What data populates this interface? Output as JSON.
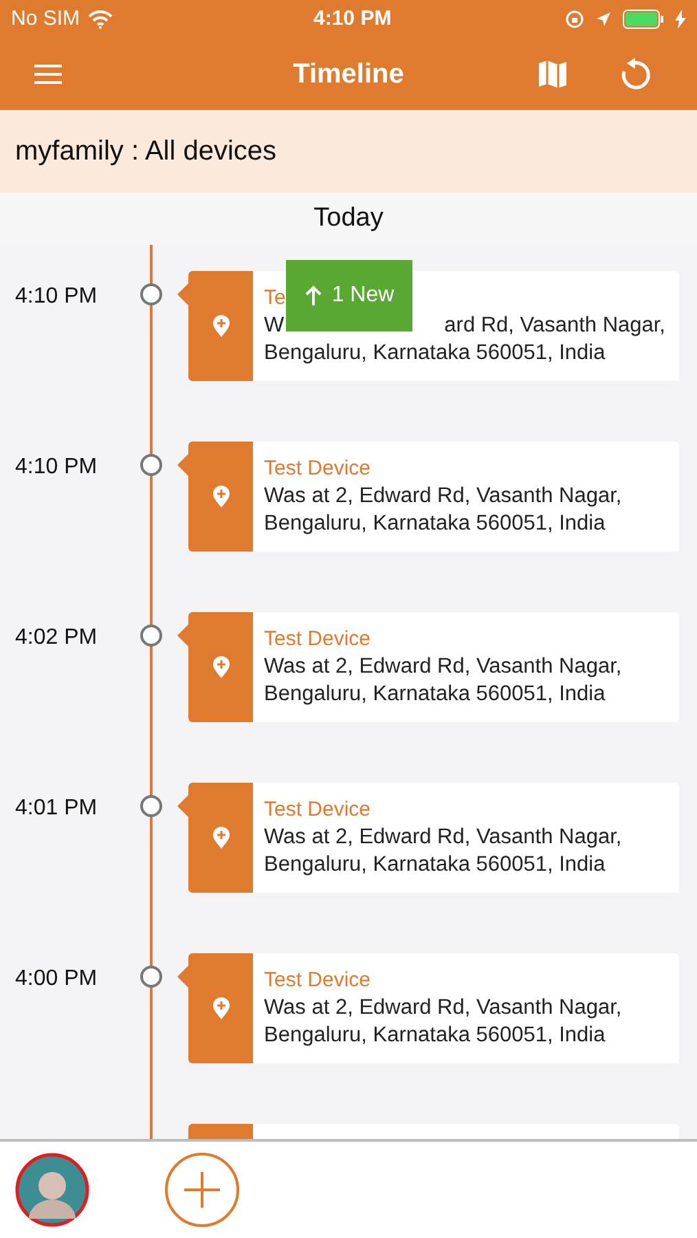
{
  "status_bar": {
    "carrier": "No SIM",
    "time": "4:10 PM"
  },
  "header": {
    "title": "Timeline"
  },
  "group_bar": {
    "text": "myfamily : All devices"
  },
  "day_heading": "Today",
  "new_badge": {
    "label": "1 New"
  },
  "entries": [
    {
      "kind": "entry",
      "time": "4:10 PM",
      "title": "Te",
      "lines": [
        [
          "W",
          "ard Rd, Vasanth Nagar,"
        ],
        [
          "Bengaluru, Karnataka 560051, India"
        ]
      ]
    },
    {
      "kind": "entry",
      "time": "4:10 PM",
      "title": "Test Device",
      "lines": [
        [
          "Was at 2, Edward Rd, Vasanth Nagar,"
        ],
        [
          "Bengaluru, Karnataka 560051, India"
        ]
      ]
    },
    {
      "kind": "entry",
      "time": "4:02 PM",
      "title": "Test Device",
      "lines": [
        [
          "Was at 2, Edward Rd, Vasanth Nagar,"
        ],
        [
          "Bengaluru, Karnataka 560051, India"
        ]
      ]
    },
    {
      "kind": "entry",
      "time": "4:01 PM",
      "title": "Test Device",
      "lines": [
        [
          "Was at 2, Edward Rd, Vasanth Nagar,"
        ],
        [
          "Bengaluru, Karnataka 560051, India"
        ]
      ]
    },
    {
      "kind": "entry",
      "time": "4:00 PM",
      "title": "Test Device",
      "lines": [
        [
          "Was at 2, Edward Rd, Vasanth Nagar,"
        ],
        [
          "Bengaluru, Karnataka 560051, India"
        ]
      ]
    },
    {
      "kind": "cut_off"
    }
  ]
}
